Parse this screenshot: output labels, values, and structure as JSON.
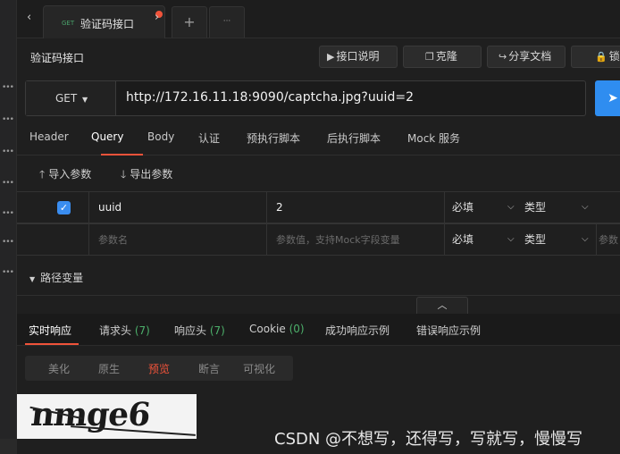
{
  "tabbar": {
    "back": "‹",
    "forward": "›",
    "active_tab": {
      "method": "GET",
      "title": "验证码接口"
    },
    "add": "+",
    "more": "···"
  },
  "header": {
    "title": "验证码接口",
    "buttons": {
      "doc": "接口说明",
      "clone": "克隆",
      "share": "分享文档",
      "lock": "锁定"
    }
  },
  "request": {
    "method": "GET",
    "url": "http://172.16.11.18:9090/captcha.jpg?uuid=2"
  },
  "req_tabs": [
    "Header",
    "Query",
    "Body",
    "认证",
    "预执行脚本",
    "后执行脚本",
    "Mock 服务"
  ],
  "active_req_tab": "Query",
  "params_toolbar": {
    "import": "导入参数",
    "export": "导出参数"
  },
  "params": {
    "row1": {
      "name": "uuid",
      "value": "2",
      "required": "必填",
      "type": "类型",
      "checked": true
    },
    "row2": {
      "name_placeholder": "参数名",
      "value_placeholder": "参数值，支持Mock字段变量",
      "required": "必填",
      "type": "类型",
      "desc_placeholder": "参数"
    }
  },
  "path_vars": "路径变量",
  "response_tabs": {
    "realtime": "实时响应",
    "req_headers": "请求头",
    "req_headers_count": "(7)",
    "resp_headers": "响应头",
    "resp_headers_count": "(7)",
    "cookie": "Cookie",
    "cookie_count": "(0)",
    "success_example": "成功响应示例",
    "error_example": "错误响应示例"
  },
  "view_modes": [
    "美化",
    "原生",
    "预览",
    "断言",
    "可视化"
  ],
  "active_view": "预览",
  "captcha_text": "nmge6",
  "watermark": "CSDN @不想写，还得写，写就写，慢慢写",
  "colors": {
    "accent": "#f0533a",
    "primary": "#2f8df0",
    "count_green": "#4caf6a"
  }
}
